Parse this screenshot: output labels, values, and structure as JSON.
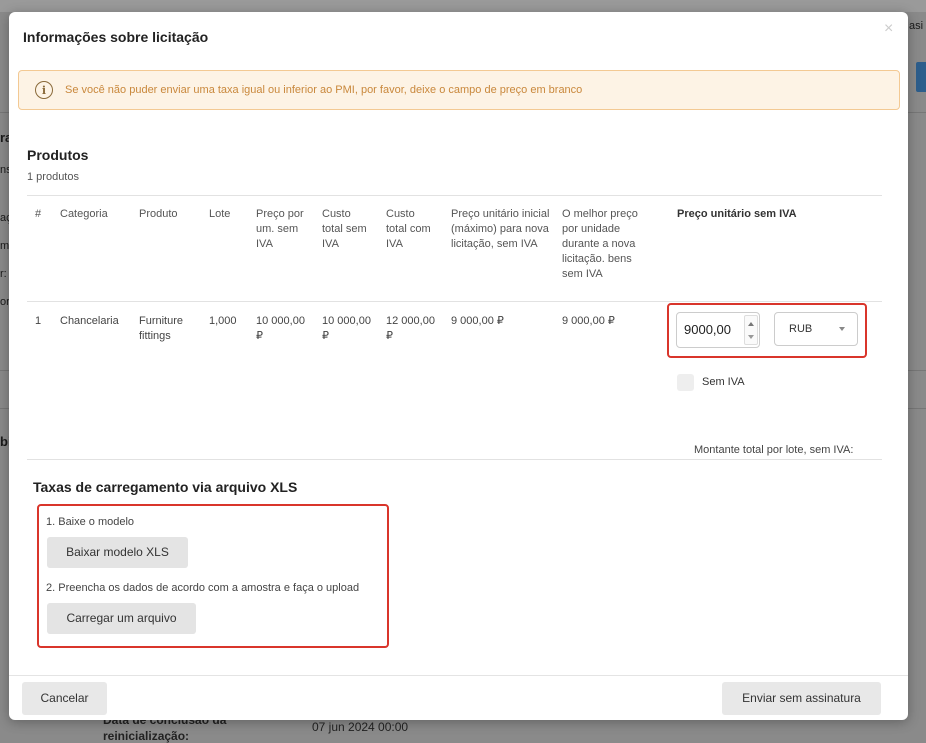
{
  "background": {
    "top_right_text": "asi",
    "side_labels": [
      "ra",
      "ns",
      "aç",
      "ma",
      "r:",
      "ora",
      "bi"
    ],
    "footer_label": "Data de conclusão da reinicialização:",
    "footer_date": "07 jun 2024 00:00"
  },
  "modal": {
    "title": "Informações sobre licitação",
    "close_icon": "×",
    "alert": {
      "icon": "i",
      "text": "Se você não puder enviar uma taxa igual ou inferior ao PMI, por favor, deixe o campo de preço em branco"
    },
    "products": {
      "title": "Produtos",
      "count": "1 produtos",
      "headers": {
        "num": "#",
        "category": "Categoria",
        "product": "Produto",
        "lot": "Lote",
        "unit_price": "Preço por um. sem IVA",
        "total_no_vat": "Custo total sem IVA",
        "total_vat": "Custo total com IVA",
        "initial_price": "Preço unitário inicial (máximo) para nova licitação, sem IVA",
        "best_price": "O melhor preço por unidade durante a nova licitação. bens sem IVA",
        "unit_no_vat": "Preço unitário sem IVA"
      },
      "rows": [
        {
          "num": "1",
          "category": "Chancelaria",
          "product": "Furniture fittings",
          "lot": "1,000",
          "unit_price": "10 000,00 ₽",
          "total_no_vat": "10 000,00 ₽",
          "total_vat": "12 000,00 ₽",
          "initial_price": "9 000,00 ₽",
          "best_price": "9 000,00 ₽",
          "price_input": "9000,00",
          "currency": "RUB",
          "no_vat_label": "Sem IVA"
        }
      ],
      "total_label": "Montante total por lote, sem IVA:"
    },
    "upload": {
      "title": "Taxas de carregamento via arquivo XLS",
      "step1": "1. Baixe o modelo",
      "download_button": "Baixar modelo XLS",
      "step2": "2. Preencha os dados de acordo com a amostra e faça o upload",
      "upload_button": "Carregar um arquivo"
    },
    "footer": {
      "cancel": "Cancelar",
      "send": "Enviar sem assinatura"
    }
  }
}
